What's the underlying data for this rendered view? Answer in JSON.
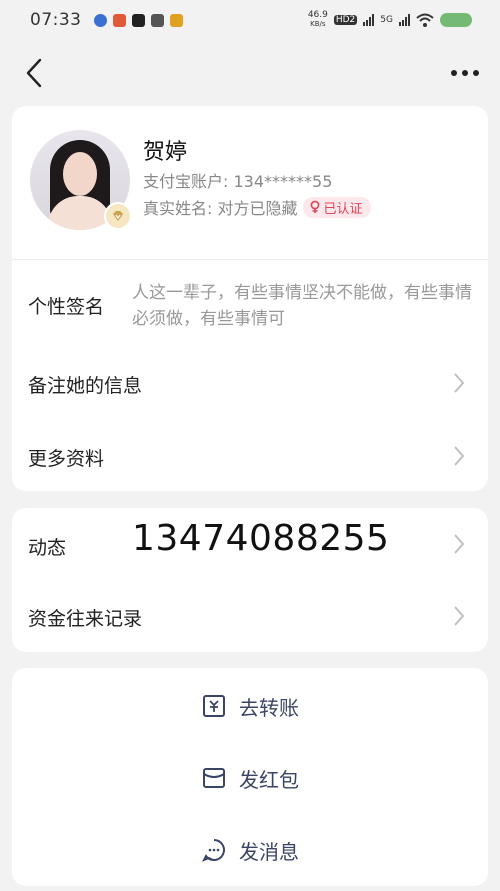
{
  "status_bar": {
    "time": "07:33",
    "net_speed": "46.9",
    "net_unit": "KB/s",
    "hd_label": "HD2",
    "gen_label": "5G"
  },
  "profile": {
    "name": "贺婷",
    "account": "支付宝账户: 134******55",
    "real_name": "真实姓名: 对方已隐藏",
    "verified_label": "已认证"
  },
  "rows": {
    "signature_label": "个性签名",
    "signature_text": "人这一辈子，有些事情坚决不能做，有些事情必须做，有些事情可",
    "remark_label": "备注她的信息",
    "more_info_label": "更多资料"
  },
  "activity": {
    "label": "动态",
    "overlay_number": "13474088255",
    "fund_records_label": "资金往来记录"
  },
  "actions": {
    "transfer_label": "去转账",
    "red_packet_label": "发红包",
    "message_label": "发消息"
  },
  "colors": {
    "accent_text": "#3a4566",
    "verified_red": "#e0445a",
    "background": "#f2f2f2"
  },
  "icons": [
    "back-arrow-icon",
    "more-dots-icon",
    "transfer-icon",
    "red-packet-icon",
    "message-icon",
    "chevron-right-icon",
    "female-icon",
    "badge-icon"
  ]
}
